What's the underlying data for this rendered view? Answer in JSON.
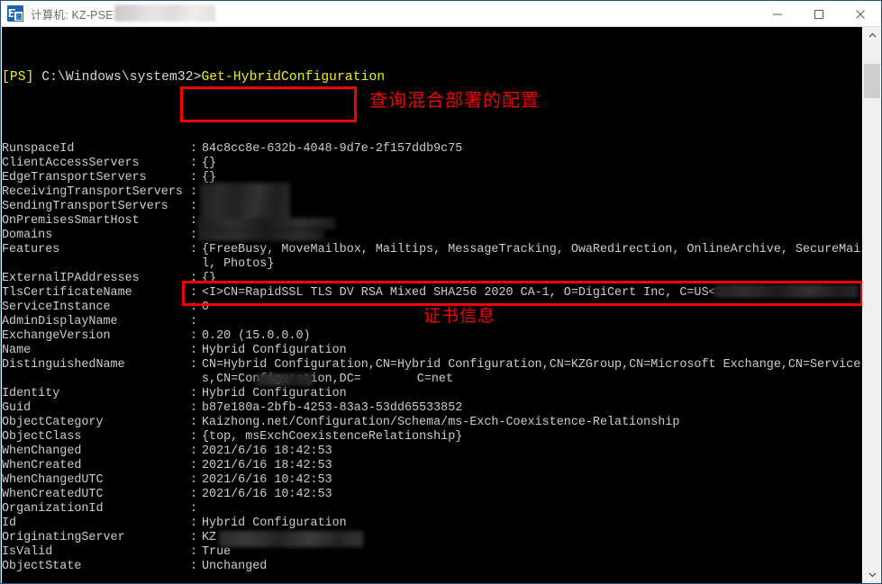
{
  "window": {
    "title_prefix": "计算机: KZ-PSE",
    "icon": "exchange-management-shell-icon",
    "controls": {
      "minimize": "minimize-icon",
      "maximize": "maximize-icon",
      "close": "close-icon"
    }
  },
  "console": {
    "prompt_tag": "[PS]",
    "prompt_path": " C:\\Windows\\system32>",
    "command": "Get-HybridConfiguration",
    "colors": {
      "background": "#000000",
      "foreground": "#cccccc",
      "prompt_yellow": "#f2f20c",
      "annotation_red": "#f50000"
    },
    "annotations": [
      {
        "id": "query-hybrid-config",
        "text": "查询混合部署的配置"
      },
      {
        "id": "certificate-info",
        "text": "证书信息"
      }
    ],
    "properties": [
      {
        "name": "RunspaceId",
        "value": "84c8cc8e-632b-4048-9d7e-2f157ddb9c75"
      },
      {
        "name": "ClientAccessServers",
        "value": "{}"
      },
      {
        "name": "EdgeTransportServers",
        "value": "{}"
      },
      {
        "name": "ReceivingTransportServers",
        "value": ""
      },
      {
        "name": "SendingTransportServers",
        "value": ""
      },
      {
        "name": "OnPremisesSmartHost",
        "value": ""
      },
      {
        "name": "Domains",
        "value": ""
      },
      {
        "name": "Features",
        "value": "{FreeBusy, MoveMailbox, Mailtips, MessageTracking, OwaRedirection, OnlineArchive, SecureMai"
      },
      {
        "name": "ExternalIPAddresses",
        "value": "{}"
      },
      {
        "name": "TlsCertificateName",
        "value": "<I>CN=RapidSSL TLS DV RSA Mixed SHA256 2020 CA-1, O=DigiCert Inc, C=US<S>CN="
      },
      {
        "name": "ServiceInstance",
        "value": "0"
      },
      {
        "name": "AdminDisplayName",
        "value": ""
      },
      {
        "name": "ExchangeVersion",
        "value": "0.20 (15.0.0.0)"
      },
      {
        "name": "Name",
        "value": "Hybrid Configuration"
      },
      {
        "name": "DistinguishedName",
        "value": "CN=Hybrid Configuration,CN=Hybrid Configuration,CN=KZGroup,CN=Microsoft Exchange,CN=Service"
      },
      {
        "name": "Identity",
        "value": "Hybrid Configuration"
      },
      {
        "name": "Guid",
        "value": "b87e180a-2bfb-4253-83a3-53dd65533852"
      },
      {
        "name": "ObjectCategory",
        "value": "Kaizhong.net/Configuration/Schema/ms-Exch-Coexistence-Relationship"
      },
      {
        "name": "ObjectClass",
        "value": "{top, msExchCoexistenceRelationship}"
      },
      {
        "name": "WhenChanged",
        "value": "2021/6/16 18:42:53"
      },
      {
        "name": "WhenCreated",
        "value": "2021/6/16 18:42:53"
      },
      {
        "name": "WhenChangedUTC",
        "value": "2021/6/16 10:42:53"
      },
      {
        "name": "WhenCreatedUTC",
        "value": "2021/6/16 10:42:53"
      },
      {
        "name": "OrganizationId",
        "value": ""
      },
      {
        "name": "Id",
        "value": "Hybrid Configuration"
      },
      {
        "name": "OriginatingServer",
        "value": "KZ"
      },
      {
        "name": "IsValid",
        "value": "True"
      },
      {
        "name": "ObjectState",
        "value": "Unchanged"
      }
    ],
    "continuations": {
      "features_line2": "l, Photos}",
      "distinguished_name_line2_a": "s,CN=Configuration,DC=",
      "distinguished_name_line2_b": "C=net"
    }
  },
  "scrollbar": {
    "up_arrow": "chevron-up-icon",
    "down_arrow": "chevron-down-icon"
  }
}
